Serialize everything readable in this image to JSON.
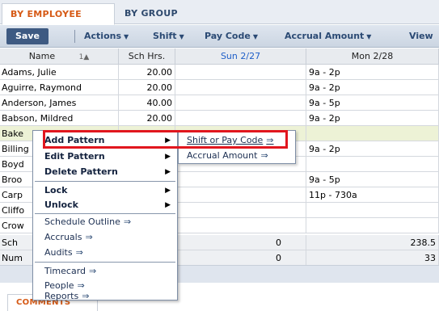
{
  "tabs": {
    "by_employee": "BY EMPLOYEE",
    "by_group": "BY GROUP"
  },
  "toolbar": {
    "save": "Save",
    "actions": "Actions",
    "shift": "Shift",
    "pay_code": "Pay Code",
    "accrual_amount": "Accrual Amount",
    "view": "View"
  },
  "grid": {
    "headers": {
      "name": "Name",
      "sort_indicator": "1▲",
      "sch_hrs": "Sch Hrs.",
      "sun": "Sun 2/27",
      "mon": "Mon 2/28"
    },
    "rows": [
      {
        "name": "Adams, Julie",
        "hrs": "20.00",
        "sun": "",
        "mon": "9a - 2p"
      },
      {
        "name": "Aguirre, Raymond",
        "hrs": "20.00",
        "sun": "",
        "mon": "9a - 2p"
      },
      {
        "name": "Anderson, James",
        "hrs": "40.00",
        "sun": "",
        "mon": "9a - 5p"
      },
      {
        "name": "Babson, Mildred",
        "hrs": "20.00",
        "sun": "",
        "mon": "9a - 2p"
      },
      {
        "name": "Bake",
        "hrs": "",
        "sun": "",
        "mon": ""
      },
      {
        "name": "Billing",
        "hrs": "",
        "sun": "",
        "mon": "9a - 2p"
      },
      {
        "name": "Boyd",
        "hrs": "",
        "sun": "",
        "mon": ""
      },
      {
        "name": "Broo",
        "hrs": "",
        "sun": "",
        "mon": "9a - 5p"
      },
      {
        "name": "Carp",
        "hrs": "",
        "sun": "",
        "mon": "11p - 730a"
      },
      {
        "name": "Cliffo",
        "hrs": "",
        "sun": "",
        "mon": ""
      },
      {
        "name": "Crow",
        "hrs": "",
        "sun": "",
        "mon": ""
      }
    ],
    "totals": [
      {
        "name": "Sch",
        "sun": "0",
        "mon": "238.5"
      },
      {
        "name": "Num",
        "sun": "0",
        "mon": "33"
      }
    ]
  },
  "context_menu": {
    "add_pattern": "Add Pattern",
    "edit_pattern": "Edit Pattern",
    "delete_pattern": "Delete Pattern",
    "lock": "Lock",
    "unlock": "Unlock",
    "schedule_outline": "Schedule Outline",
    "accruals": "Accruals",
    "audits": "Audits",
    "timecard": "Timecard",
    "people": "People",
    "reports": "Reports"
  },
  "submenu": {
    "shift_or_pay_code": "Shift or Pay Code",
    "accrual_amount": "Accrual Amount"
  },
  "comments_tab": "COMMENTS",
  "colors": {
    "highlight": "#e1161e",
    "accent_orange": "#d65a16",
    "toolbar_text": "#2b4a74",
    "selected_row": "#edf2d6"
  },
  "icons": {
    "menu_arrow": "triangle-right-icon",
    "go_arrow": "double-arrow-right-icon",
    "dropdown": "caret-down-icon"
  }
}
